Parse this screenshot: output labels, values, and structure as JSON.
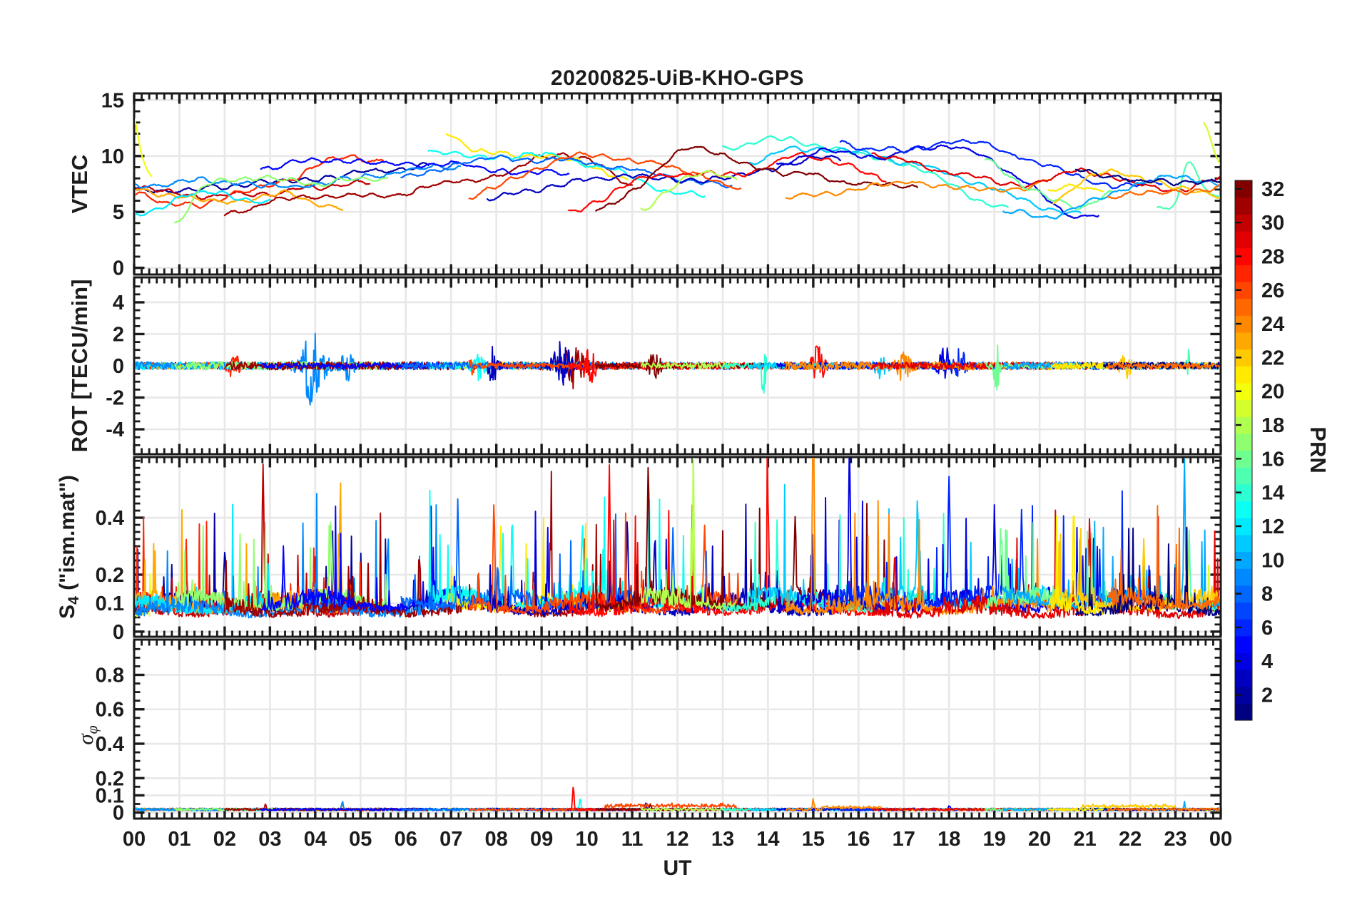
{
  "chart_data": {
    "type": "line",
    "title": "20200825-UiB-KHO-GPS",
    "xlabel": "UT",
    "seed": 1337,
    "style": {
      "frame": "#1a1a1a",
      "grid": "#e8e8e8",
      "bg": "#ffffff",
      "text": "#1c1c1c"
    },
    "x": {
      "min": 0,
      "max": 24,
      "minor_per_hour": 6,
      "hour_labels": [
        "00",
        "01",
        "02",
        "03",
        "04",
        "05",
        "06",
        "07",
        "08",
        "09",
        "10",
        "11",
        "12",
        "13",
        "14",
        "15",
        "16",
        "17",
        "18",
        "19",
        "20",
        "21",
        "22",
        "23",
        "00"
      ]
    },
    "colorbar": {
      "label": "PRN",
      "min": 1,
      "max": 32,
      "levels": 32,
      "ticks": [
        2,
        4,
        6,
        8,
        10,
        12,
        14,
        16,
        18,
        20,
        22,
        24,
        26,
        28,
        30,
        32
      ]
    },
    "panels": [
      {
        "id": "vtec",
        "ylabel": "VTEC",
        "ylim": [
          -0.6,
          15.6
        ],
        "minor": 1,
        "yticks": [
          {
            "v": 0,
            "label": "0"
          },
          {
            "v": 5,
            "label": "5"
          },
          {
            "v": 10,
            "label": "10"
          },
          {
            "v": 15,
            "label": "15"
          }
        ]
      },
      {
        "id": "rot",
        "ylabel": "ROT [TECU/min]",
        "ylim": [
          -5.57,
          5.57
        ],
        "minor": 0.5,
        "yticks": [
          {
            "v": -4,
            "label": "-4"
          },
          {
            "v": -2,
            "label": "-2"
          },
          {
            "v": 0,
            "label": "0"
          },
          {
            "v": 2,
            "label": "2"
          },
          {
            "v": 4,
            "label": "4"
          }
        ]
      },
      {
        "id": "s4",
        "ylabel_main": "S",
        "ylabel_sub": "4",
        "ylabel_rest": " (\"ism.mat\")",
        "ylim": [
          -0.018,
          0.613
        ],
        "minor": 0.025,
        "yticks": [
          {
            "v": 0,
            "label": "0"
          },
          {
            "v": 0.1,
            "label": "0.1"
          },
          {
            "v": 0.2,
            "label": "0.2"
          },
          {
            "v": 0.4,
            "label": "0.4"
          }
        ]
      },
      {
        "id": "sigma_phi",
        "ylabel_main": "σ",
        "ylabel_sub": "φ",
        "ylim": [
          -0.035,
          1.005
        ],
        "minor": 0.05,
        "yticks": [
          {
            "v": 0,
            "label": "0"
          },
          {
            "v": 0.1,
            "label": "0.1"
          },
          {
            "v": 0.2,
            "label": "0.2"
          },
          {
            "v": 0.4,
            "label": "0.4"
          },
          {
            "v": 0.6,
            "label": "0.6"
          },
          {
            "v": 0.8,
            "label": "0.8"
          }
        ]
      }
    ],
    "arcs": [
      {
        "p": 20,
        "t": [
          0,
          0.18,
          0.38
        ],
        "v": [
          13.3,
          10.0,
          8.2
        ]
      },
      {
        "p": 19,
        "t": [
          23.62,
          23.82,
          24
        ],
        "v": [
          12.9,
          11.0,
          9.4
        ]
      },
      {
        "p": 2,
        "t": [
          0,
          1.5,
          3.5,
          5.2,
          6.5
        ],
        "v": [
          7.0,
          7.2,
          7.9,
          8.7,
          9.0
        ]
      },
      {
        "p": 30,
        "t": [
          0,
          1.2,
          2.6,
          4.0,
          5.2
        ],
        "v": [
          7.2,
          6.4,
          6.7,
          7.3,
          7.9
        ]
      },
      {
        "p": 27,
        "t": [
          0,
          0.8,
          2.2,
          3.6,
          4.6,
          5.5
        ],
        "v": [
          6.6,
          5.7,
          6.6,
          8.3,
          9.9,
          9.5
        ]
      },
      {
        "p": 23,
        "t": [
          0,
          1.0,
          2.2,
          3.4,
          4.6
        ],
        "v": [
          7.0,
          6.3,
          6.0,
          6.6,
          5.2
        ]
      },
      {
        "p": 12,
        "t": [
          0,
          0.8,
          1.8,
          3.0
        ],
        "v": [
          4.8,
          5.9,
          6.8,
          5.8
        ]
      },
      {
        "p": 9,
        "t": [
          0,
          1.6,
          3.2,
          4.8,
          6.2,
          7.2
        ],
        "v": [
          7.4,
          7.9,
          7.2,
          8.0,
          8.7,
          8.9
        ]
      },
      {
        "p": 17,
        "t": [
          0.9,
          1.6,
          2.8,
          4.2,
          5.6
        ],
        "v": [
          4.0,
          7.4,
          8.1,
          7.7,
          8.0
        ]
      },
      {
        "p": 31,
        "t": [
          2.0,
          3.4,
          5.0,
          6.6,
          8.2,
          9.3,
          10.2,
          11.0
        ],
        "v": [
          4.7,
          6.1,
          6.4,
          7.3,
          8.4,
          10.3,
          9.3,
          7.3
        ]
      },
      {
        "p": 5,
        "t": [
          2.8,
          4.2,
          5.6,
          7.2,
          8.6,
          9.6
        ],
        "v": [
          8.9,
          9.7,
          9.3,
          9.1,
          8.6,
          8.4
        ]
      },
      {
        "p": 21,
        "t": [
          6.9,
          7.6,
          8.6,
          9.8,
          10.9
        ],
        "v": [
          12.2,
          10.3,
          10.0,
          9.4,
          7.9
        ]
      },
      {
        "p": 13,
        "t": [
          6.5,
          7.6,
          9.0,
          10.4,
          11.6,
          12.6
        ],
        "v": [
          10.5,
          9.9,
          10.2,
          8.9,
          7.2,
          6.4
        ]
      },
      {
        "p": 8,
        "t": [
          5.9,
          7.2,
          8.6,
          10.0,
          11.6,
          13.2
        ],
        "v": [
          8.0,
          9.4,
          9.7,
          9.2,
          8.2,
          7.4
        ]
      },
      {
        "p": 3,
        "t": [
          7.8,
          9.2,
          10.8,
          12.4,
          14.0,
          15.6
        ],
        "v": [
          6.3,
          7.2,
          8.2,
          8.0,
          8.7,
          9.9
        ]
      },
      {
        "p": 26,
        "t": [
          7.4,
          8.6,
          9.8,
          11.0,
          12.2,
          13.4
        ],
        "v": [
          6.3,
          8.4,
          10.1,
          9.6,
          8.7,
          6.9
        ]
      },
      {
        "p": 28,
        "t": [
          9.6,
          10.8,
          12.0,
          13.2,
          14.6,
          15.6,
          16.6
        ],
        "v": [
          4.9,
          7.4,
          8.4,
          8.3,
          9.9,
          9.3,
          7.8
        ]
      },
      {
        "p": 32,
        "t": [
          10.2,
          11.2,
          12.2,
          13.4,
          14.8,
          16.0,
          17.3
        ],
        "v": [
          5.2,
          7.5,
          10.7,
          9.5,
          8.4,
          7.6,
          7.1
        ]
      },
      {
        "p": 18,
        "t": [
          11.2,
          12.0,
          12.8,
          13.3
        ],
        "v": [
          5.3,
          7.6,
          8.4,
          8.0
        ]
      },
      {
        "p": 14,
        "t": [
          13.0,
          14.2,
          15.4,
          16.6,
          17.8,
          18.6,
          19.3
        ],
        "v": [
          10.8,
          11.5,
          10.5,
          9.6,
          8.1,
          6.3,
          5.3
        ]
      },
      {
        "p": 11,
        "t": [
          13.6,
          14.8,
          16.2,
          17.6,
          19.0,
          20.0,
          20.9
        ],
        "v": [
          9.4,
          10.8,
          10.1,
          8.8,
          7.2,
          5.6,
          4.7
        ]
      },
      {
        "p": 4,
        "t": [
          14.2,
          15.4,
          16.6,
          17.6,
          18.6,
          19.6,
          20.6,
          21.3
        ],
        "v": [
          9.3,
          10.5,
          9.8,
          10.9,
          10.2,
          8.1,
          5.0,
          4.7
        ]
      },
      {
        "p": 6,
        "t": [
          15.6,
          16.8,
          18.0,
          19.2,
          20.4,
          21.6,
          22.7
        ],
        "v": [
          11.2,
          10.3,
          11.2,
          10.5,
          8.8,
          7.4,
          7.9
        ]
      },
      {
        "p": 24,
        "t": [
          14.4,
          15.6,
          16.8,
          18.0,
          19.2,
          20.3
        ],
        "v": [
          6.4,
          7.0,
          7.4,
          7.2,
          6.6,
          7.9
        ]
      },
      {
        "p": 29,
        "t": [
          16.3,
          17.4,
          18.6,
          19.8,
          21.0,
          22.2,
          23.2,
          24
        ],
        "v": [
          10.2,
          9.0,
          8.0,
          7.6,
          8.6,
          7.3,
          7.2,
          8.0
        ]
      },
      {
        "p": 16,
        "t": [
          18.8,
          19.8,
          20.8,
          21.6
        ],
        "v": [
          9.6,
          7.1,
          5.6,
          6.8
        ]
      },
      {
        "p": 15,
        "t": [
          22.6,
          23.0,
          23.3,
          23.7,
          24
        ],
        "v": [
          5.2,
          6.0,
          9.7,
          6.9,
          6.6
        ]
      },
      {
        "p": 10,
        "t": [
          19.2,
          20.2,
          21.4,
          22.6,
          23.4,
          24
        ],
        "v": [
          5.0,
          4.7,
          6.2,
          7.8,
          8.0,
          7.4
        ]
      },
      {
        "p": 22,
        "t": [
          20.3,
          21.2,
          22.2,
          23.1,
          24
        ],
        "v": [
          6.0,
          8.3,
          8.0,
          7.2,
          6.8
        ]
      },
      {
        "p": 1,
        "t": [
          20.8,
          21.8,
          22.8,
          24
        ],
        "v": [
          8.7,
          8.0,
          7.6,
          7.8
        ]
      },
      {
        "p": 21,
        "t": [
          20.2,
          20.8,
          21.4
        ],
        "v": [
          6.8,
          7.3,
          7.0
        ]
      },
      {
        "p": 25,
        "t": [
          21.5,
          22.3,
          23.1,
          24
        ],
        "v": [
          6.2,
          7.0,
          6.6,
          7.3
        ]
      }
    ],
    "rot_bursts": [
      [
        7,
        3.95,
        0.55,
        2.4
      ],
      [
        14,
        9.45,
        0.45,
        1.5
      ],
      [
        9,
        9.7,
        0.5,
        1.2
      ],
      [
        16,
        10.05,
        0.35,
        1.0
      ],
      [
        15,
        7.35,
        0.3,
        1.0
      ],
      [
        14,
        7.9,
        0.25,
        1.2
      ],
      [
        17,
        11.5,
        0.3,
        0.9
      ],
      [
        19,
        13.9,
        0.12,
        1.9
      ],
      [
        21,
        17.9,
        0.3,
        1.2
      ],
      [
        22,
        18.25,
        0.25,
        1.0
      ],
      [
        25,
        19.05,
        0.15,
        1.6
      ],
      [
        16,
        15.1,
        0.3,
        1.1
      ],
      [
        28,
        21.9,
        0.3,
        0.7
      ],
      [
        4,
        2.2,
        0.3,
        0.7
      ],
      [
        12,
        7.6,
        0.3,
        0.8
      ],
      [
        20,
        16.5,
        0.3,
        0.7
      ],
      [
        23,
        17.0,
        0.35,
        0.8
      ],
      [
        7,
        4.7,
        0.3,
        0.8
      ],
      [
        26,
        23.3,
        0.1,
        1.2
      ]
    ],
    "s4_spikes": [
      [
        4,
        1.15,
        0.22
      ],
      [
        2,
        2.0,
        0.2
      ],
      [
        3,
        2.85,
        0.4
      ],
      [
        6,
        3.55,
        0.34
      ],
      [
        10,
        3.3,
        0.18
      ],
      [
        8,
        4.35,
        0.24
      ],
      [
        5,
        4.55,
        0.45
      ],
      [
        5,
        4.75,
        0.4
      ],
      [
        7,
        5.6,
        0.2
      ],
      [
        9,
        6.3,
        0.2
      ],
      [
        13,
        7.15,
        0.3
      ],
      [
        15,
        7.95,
        0.38
      ],
      [
        11,
        8.1,
        0.32
      ],
      [
        12,
        8.35,
        0.25
      ],
      [
        9,
        9.2,
        0.27
      ],
      [
        12,
        9.9,
        0.22
      ],
      [
        16,
        10.5,
        0.5
      ],
      [
        14,
        10.9,
        0.28
      ],
      [
        17,
        11.35,
        0.47
      ],
      [
        14,
        11.5,
        0.3
      ],
      [
        13,
        11.9,
        0.24
      ],
      [
        18,
        12.35,
        0.3
      ],
      [
        15,
        12.6,
        0.25
      ],
      [
        20,
        12.9,
        0.43
      ],
      [
        16,
        14.0,
        0.3
      ],
      [
        19,
        14.2,
        0.25
      ],
      [
        17,
        14.6,
        0.26
      ],
      [
        23,
        15.0,
        0.75
      ],
      [
        21,
        15.8,
        0.44
      ],
      [
        24,
        16.8,
        0.22
      ],
      [
        20,
        17.3,
        0.3
      ],
      [
        22,
        18.0,
        0.37
      ],
      [
        21,
        19.0,
        0.33
      ],
      [
        25,
        19.15,
        0.25
      ],
      [
        22,
        19.6,
        0.28
      ],
      [
        30,
        20.75,
        0.28
      ],
      [
        27,
        20.9,
        0.22
      ],
      [
        24,
        21.1,
        0.24
      ],
      [
        28,
        22.3,
        0.26
      ],
      [
        27,
        23.2,
        0.45
      ],
      [
        26,
        23.3,
        0.22
      ]
    ],
    "sigma_spikes": [
      [
        16,
        9.7,
        0.155
      ],
      [
        12,
        9.85,
        0.06
      ],
      [
        7,
        4.6,
        0.055
      ],
      [
        23,
        15.0,
        0.065
      ],
      [
        14,
        11.3,
        0.04
      ],
      [
        3,
        2.9,
        0.035
      ],
      [
        21,
        18.0,
        0.035
      ],
      [
        27,
        23.2,
        0.04
      ],
      [
        17,
        11.4,
        0.035
      ],
      [
        6,
        3.6,
        0.03
      ],
      [
        5,
        4.6,
        0.035
      ],
      [
        20,
        12.9,
        0.035
      ]
    ],
    "sigma_bands": [
      [
        15,
        10.4,
        13.3,
        0.022
      ],
      [
        28,
        20.9,
        23.0,
        0.018
      ],
      [
        23,
        15.2,
        16.5,
        0.012
      ]
    ]
  }
}
